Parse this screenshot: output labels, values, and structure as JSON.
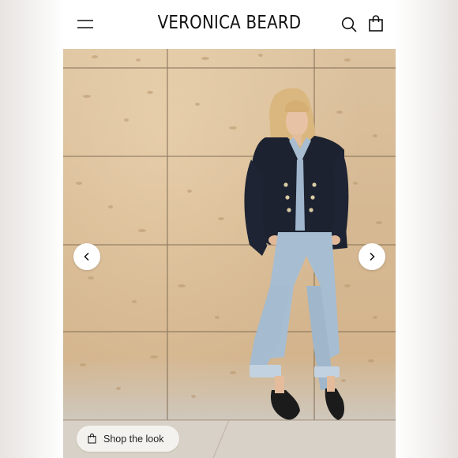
{
  "header": {
    "brand": "VERONICA BEARD",
    "menu_icon": "hamburger-menu-icon",
    "search_icon": "search-icon",
    "cart_icon": "shopping-bag-icon"
  },
  "hero": {
    "image_alt": "Model in navy double-breasted blazer, denim shirt and wide-leg cuffed jeans leaning against a stone wall",
    "prev_icon": "chevron-left-icon",
    "next_icon": "chevron-right-icon"
  },
  "shop_the_look": {
    "label": "Shop the look",
    "icon": "shopping-bag-icon"
  },
  "colors": {
    "stone_wall": "#d6b993",
    "blazer": "#1c2230",
    "denim": "#a7bdd2"
  }
}
